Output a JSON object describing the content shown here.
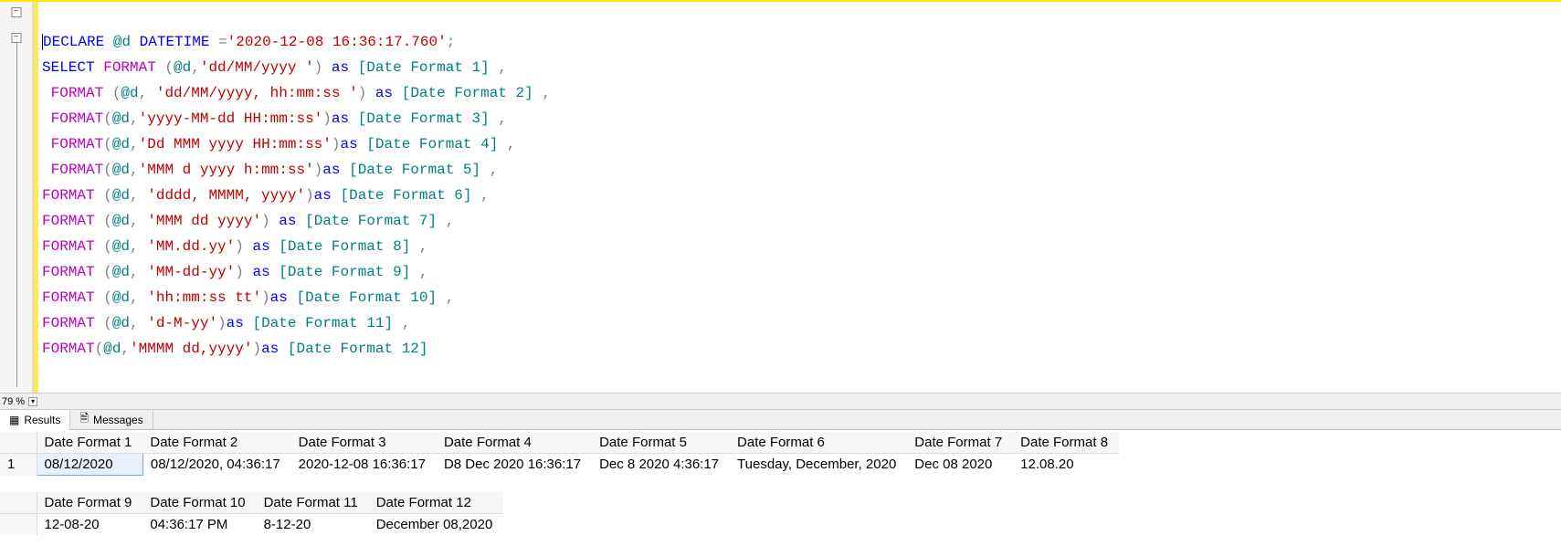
{
  "zoom": "79 %",
  "tabs": {
    "results": "Results",
    "messages": "Messages"
  },
  "code": {
    "l1": {
      "declare": "DECLARE",
      "var": "@d",
      "type": "DATETIME",
      "eq": "=",
      "str": "'2020-12-08 16:36:17.760'",
      "semi": ";"
    },
    "l2": {
      "select": "SELECT",
      "fn": "FORMAT",
      "open": " (",
      "var": "@d",
      "c": ",",
      "str": "'dd/MM/yyyy '",
      "close": ")",
      "as": "as",
      "alias": "[Date Format 1]",
      "comma": " ,"
    },
    "l3": {
      "fn": "FORMAT",
      "open": " (",
      "var": "@d",
      "c": ",",
      "sp": " ",
      "str": "'dd/MM/yyyy, hh:mm:ss '",
      "close": ")",
      "as": "as",
      "alias": "[Date Format 2]",
      "comma": " ,"
    },
    "l4": {
      "fn": "FORMAT",
      "open": "(",
      "var": "@d",
      "c": ",",
      "str": "'yyyy-MM-dd HH:mm:ss'",
      "close": ")",
      "as": "as",
      "alias": "[Date Format 3]",
      "comma": " ,"
    },
    "l5": {
      "fn": "FORMAT",
      "open": "(",
      "var": "@d",
      "c": ",",
      "str": "'Dd MMM yyyy HH:mm:ss'",
      "close": ")",
      "as": "as",
      "alias": "[Date Format 4]",
      "comma": " ,"
    },
    "l6": {
      "fn": "FORMAT",
      "open": "(",
      "var": "@d",
      "c": ",",
      "str": "'MMM d yyyy h:mm:ss'",
      "close": ")",
      "as": "as",
      "alias": "[Date Format 5]",
      "comma": " ,"
    },
    "l7": {
      "fn": "FORMAT",
      "open": " (",
      "var": "@d",
      "c": ",",
      "sp": " ",
      "str": "'dddd, MMMM, yyyy'",
      "close": ")",
      "as": "as",
      "alias": "[Date Format 6]",
      "comma": " ,"
    },
    "l8": {
      "fn": "FORMAT",
      "open": " (",
      "var": "@d",
      "c": ",",
      "sp": " ",
      "str": "'MMM dd yyyy'",
      "close": ")",
      "sp2": " ",
      "as": "as",
      "alias": "[Date Format 7]",
      "comma": " ,"
    },
    "l9": {
      "fn": "FORMAT",
      "open": " (",
      "var": "@d",
      "c": ",",
      "sp": " ",
      "str": "'MM.dd.yy'",
      "close": ")",
      "sp2": " ",
      "as": "as",
      "alias": "[Date Format 8]",
      "comma": " ,"
    },
    "l10": {
      "fn": "FORMAT",
      "open": " (",
      "var": "@d",
      "c": ",",
      "sp": " ",
      "str": "'MM-dd-yy'",
      "close": ")",
      "sp2": " ",
      "as": "as",
      "alias": "[Date Format 9]",
      "comma": " ,"
    },
    "l11": {
      "fn": "FORMAT",
      "open": " (",
      "var": "@d",
      "c": ",",
      "sp": " ",
      "str": "'hh:mm:ss tt'",
      "close": ")",
      "as": "as",
      "alias": "[Date Format 10]",
      "comma": " ,"
    },
    "l12": {
      "fn": "FORMAT",
      "open": " (",
      "var": "@d",
      "c": ",",
      "sp": " ",
      "str": "'d-M-yy'",
      "close": ")",
      "as": "as",
      "alias": "[Date Format 11]",
      "comma": " ,"
    },
    "l13": {
      "fn": "FORMAT",
      "open": "(",
      "var": "@d",
      "c": ",",
      "str": "'MMMM dd,yyyy'",
      "close": ")",
      "as": "as",
      "alias": "[Date Format 12]"
    }
  },
  "grid1": {
    "row_no": "1",
    "headers": [
      "Date Format 1",
      "Date Format 2",
      "Date Format 3",
      "Date Format 4",
      "Date Format 5",
      "Date Format 6",
      "Date Format 7",
      "Date Format 8"
    ],
    "row": [
      "08/12/2020",
      "08/12/2020, 04:36:17",
      "2020-12-08 16:36:17",
      "D8 Dec 2020 16:36:17",
      "Dec 8 2020 4:36:17",
      "Tuesday, December, 2020",
      "Dec 08 2020",
      "12.08.20"
    ]
  },
  "grid2": {
    "headers": [
      "Date Format 9",
      "Date Format 10",
      "Date Format 11",
      "Date Format 12"
    ],
    "row": [
      "12-08-20",
      "04:36:17 PM",
      "8-12-20",
      "December 08,2020"
    ]
  }
}
